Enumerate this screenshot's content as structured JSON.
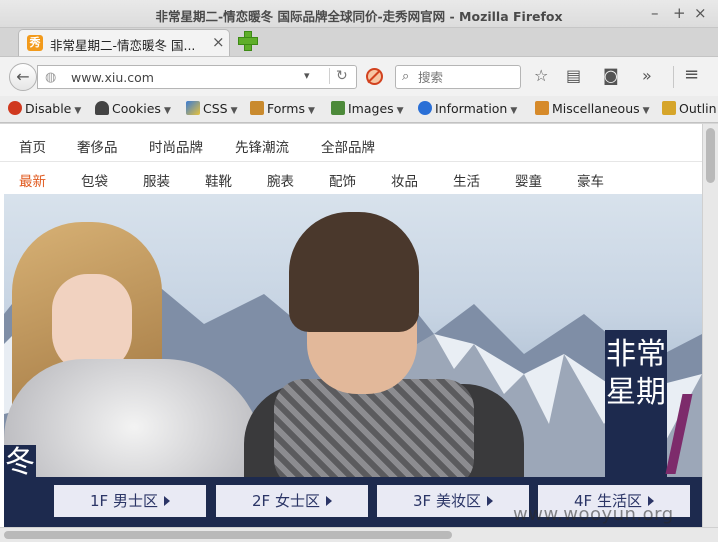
{
  "window": {
    "title": "非常星期二-情恋暖冬 国际品牌全球同价-走秀网官网 - Mozilla Firefox",
    "min_glyph": "–",
    "max_glyph": "+",
    "close_glyph": "×"
  },
  "tab": {
    "label": "非常星期二-情恋暖冬 国...",
    "favicon_text": "秀",
    "close_glyph": "×"
  },
  "navbar": {
    "url": "www.xiu.com",
    "search_placeholder": "搜索",
    "back_glyph": "←",
    "reload_glyph": "↻",
    "dropdown_glyph": "▾",
    "overflow_glyph": "»",
    "menu_glyph": "≡",
    "icons": [
      "bookmark-star-icon",
      "reading-list-icon",
      "pocket-icon",
      "overflow-icon",
      "menu-icon"
    ]
  },
  "devbar": {
    "items": [
      {
        "label": "Disable",
        "icon": "disable-icon",
        "color": "#d0391f"
      },
      {
        "label": "Cookies",
        "icon": "cookies-icon",
        "color": "#444444"
      },
      {
        "label": "CSS",
        "icon": "css-icon",
        "color": "#3a7bd5"
      },
      {
        "label": "Forms",
        "icon": "forms-icon",
        "color": "#c98a2e"
      },
      {
        "label": "Images",
        "icon": "images-icon",
        "color": "#4d8a3a"
      },
      {
        "label": "Information",
        "icon": "information-icon",
        "color": "#2a6fd6"
      },
      {
        "label": "Miscellaneous",
        "icon": "miscellaneous-icon",
        "color": "#d68a2a"
      },
      {
        "label": "Outlin",
        "icon": "outline-icon",
        "color": "#d6a52a"
      }
    ]
  },
  "site": {
    "nav_primary": [
      "首页",
      "奢侈品",
      "时尚品牌",
      "先锋潮流",
      "全部品牌"
    ],
    "nav_secondary": [
      "最新",
      "包袋",
      "服装",
      "鞋靴",
      "腕表",
      "配饰",
      "妆品",
      "生活",
      "婴童",
      "豪车"
    ],
    "active_secondary": "最新",
    "accent_color": "#e05a1f",
    "banner": {
      "slogan": "非常星期",
      "left_mark": "冬",
      "floors": [
        "1F 男士区",
        "2F 女士区",
        "3F 美妆区",
        "4F 生活区"
      ],
      "bar_color": "#1d2a4e"
    }
  },
  "watermark": "www.wooyun.org"
}
